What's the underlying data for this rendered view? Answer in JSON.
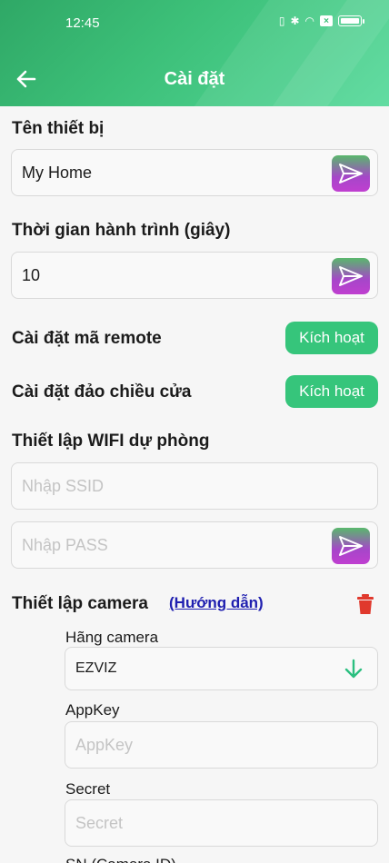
{
  "status_bar": {
    "time": "12:45"
  },
  "header": {
    "title": "Cài đặt"
  },
  "device_name": {
    "label": "Tên thiết bị",
    "value": "My Home"
  },
  "travel_time": {
    "label": "Thời gian hành trình (giây)",
    "value": "10"
  },
  "remote_code": {
    "label": "Cài đặt mã remote",
    "button": "Kích hoạt"
  },
  "door_reverse": {
    "label": "Cài đặt đảo chiều cửa",
    "button": "Kích hoạt"
  },
  "wifi": {
    "label": "Thiết lập WIFI dự phòng",
    "ssid_placeholder": "Nhập SSID",
    "pass_placeholder": "Nhập PASS"
  },
  "camera": {
    "label": "Thiết lập camera",
    "guide_link": "(Hướng dẫn)",
    "brand_label": "Hãng camera",
    "brand_value": "EZVIZ",
    "appkey_label": "AppKey",
    "appkey_placeholder": "AppKey",
    "secret_label": "Secret",
    "secret_placeholder": "Secret",
    "serial_label": "SN (Camera ID)"
  },
  "colors": {
    "accent": "#36c57b",
    "link": "#2020b0",
    "delete": "#e0392d"
  },
  "icons": [
    "arrow-left-icon",
    "send-icon",
    "trash-icon",
    "arrow-down-icon"
  ]
}
